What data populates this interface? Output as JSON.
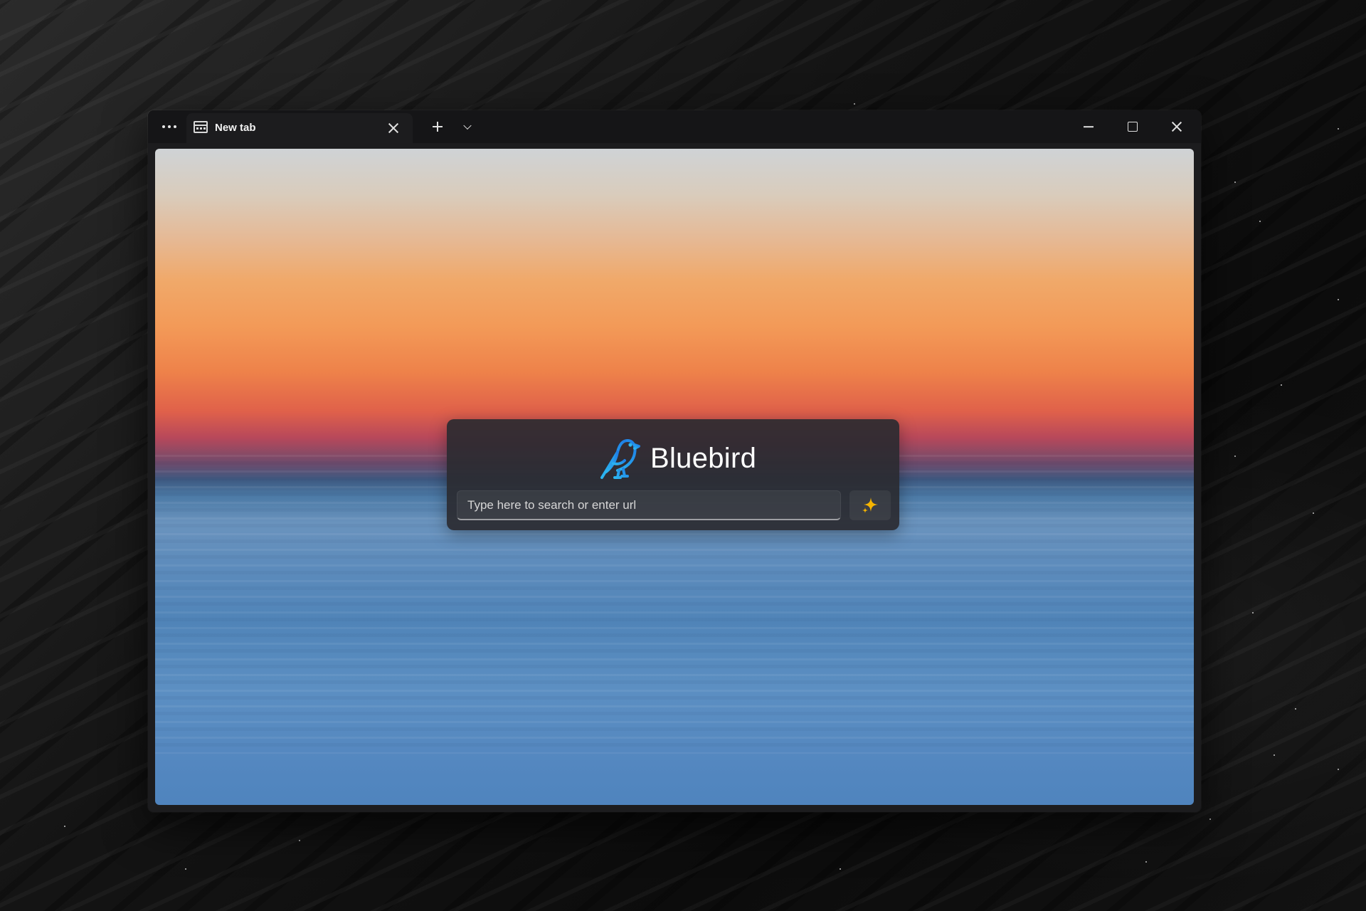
{
  "window": {
    "menu_icon": "more-dots-icon",
    "tab": {
      "title": "New tab",
      "icon": "tab-page-icon",
      "close_icon": "close-icon"
    },
    "new_tab_icon": "plus-icon",
    "tab_list_icon": "chevron-down-icon",
    "controls": {
      "minimize_icon": "minimize-icon",
      "maximize_icon": "maximize-icon",
      "close_icon": "close-icon"
    }
  },
  "new_tab_page": {
    "brand": {
      "name": "Bluebird",
      "logo_icon": "bluebird-logo-icon",
      "logo_colors": [
        "#2cb6f0",
        "#1e7ee6"
      ]
    },
    "search": {
      "placeholder": "Type here to search or enter url",
      "value": ""
    },
    "ai_button": {
      "icon": "sparkle-icon",
      "color": "#f5b400"
    }
  }
}
